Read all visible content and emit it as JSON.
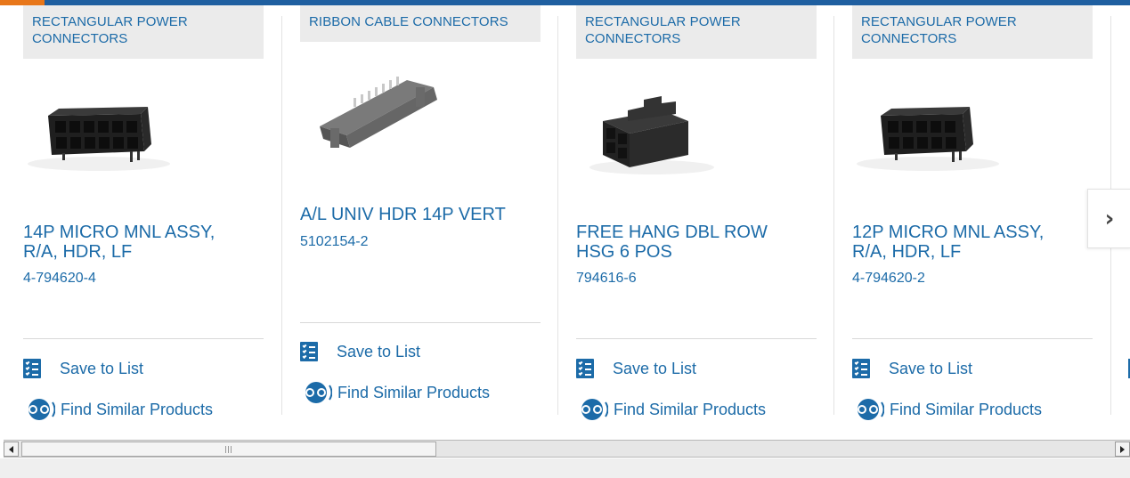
{
  "cards": [
    {
      "category": "RECTANGULAR POWER CONNECTORS",
      "title": "14P MICRO MNL ASSY, R/A, HDR, LF",
      "part_number": "4-794620-4",
      "save_label": "Save to List",
      "similar_label": "Find Similar Products",
      "image_icon": "right-angle-header-connector"
    },
    {
      "category": "RIBBON CABLE CONNECTORS",
      "title": "A/L UNIV HDR 14P VERT",
      "part_number": "5102154-2",
      "save_label": "Save to List",
      "similar_label": "Find Similar Products",
      "image_icon": "ribbon-header-connector"
    },
    {
      "category": "RECTANGULAR POWER CONNECTORS",
      "title": "FREE HANG DBL ROW HSG 6 POS",
      "part_number": "794616-6",
      "save_label": "Save to List",
      "similar_label": "Find Similar Products",
      "image_icon": "six-position-housing-connector"
    },
    {
      "category": "RECTANGULAR POWER CONNECTORS",
      "title": "12P MICRO MNL ASSY, R/A, HDR, LF",
      "part_number": "4-794620-2",
      "save_label": "Save to List",
      "similar_label": "Find Similar Products",
      "image_icon": "right-angle-header-connector"
    }
  ],
  "next_icon": "chevron-right-icon",
  "colors": {
    "link": "#1c6ba8",
    "top_bar": "#1f5fa0",
    "top_bar_accent": "#e8771a",
    "category_bg": "#ebebeb"
  }
}
